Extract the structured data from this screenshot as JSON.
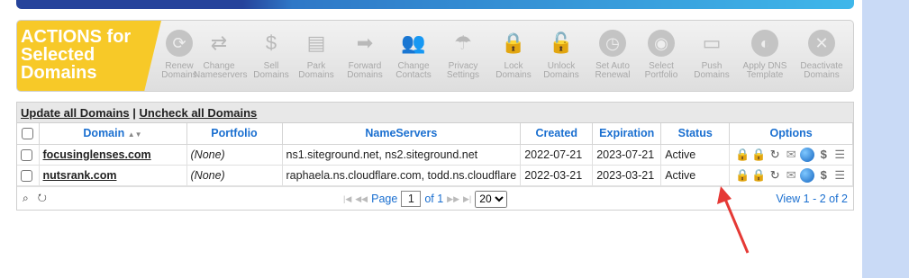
{
  "actions": {
    "title": "ACTIONS for\nSelected\nDomains",
    "items": [
      {
        "label": "Renew Domains",
        "icon": "renew-icon",
        "glyph": "⟳"
      },
      {
        "label": "Change Nameservers",
        "icon": "arrows-icon",
        "glyph": "⇄"
      },
      {
        "label": "Sell Domains",
        "icon": "dollar-icon",
        "glyph": "$"
      },
      {
        "label": "Park Domains",
        "icon": "bus-icon",
        "glyph": "▤"
      },
      {
        "label": "Forward Domains",
        "icon": "forward-arrow-icon",
        "glyph": "➡"
      },
      {
        "label": "Change Contacts",
        "icon": "contacts-icon",
        "glyph": "👥"
      },
      {
        "label": "Privacy Settings",
        "icon": "privacy-icon",
        "glyph": "☂"
      },
      {
        "label": "Lock Domains",
        "icon": "lock-icon",
        "glyph": "🔒"
      },
      {
        "label": "Unlock Domains",
        "icon": "unlock-icon",
        "glyph": "🔓"
      },
      {
        "label": "Set Auto Renewal",
        "icon": "clock-icon",
        "glyph": "◷"
      },
      {
        "label": "Select Portfolio",
        "icon": "disc-icon",
        "glyph": "◉"
      },
      {
        "label": "Push Domains",
        "icon": "computers-icon",
        "glyph": "▭"
      },
      {
        "label": "Apply DNS Template",
        "icon": "dns-template-icon",
        "glyph": "◐"
      },
      {
        "label": "Deactivate Domains",
        "icon": "deactivate-icon",
        "glyph": "✕"
      }
    ]
  },
  "grid": {
    "update_all_label": "Update all Domains",
    "separator": " | ",
    "uncheck_all_label": "Uncheck all Domains",
    "columns": [
      "Domain",
      "Portfolio",
      "NameServers",
      "Created",
      "Expiration",
      "Status",
      "Options"
    ],
    "sort_indicator": "▲▼",
    "rows": [
      {
        "domain": "focusinglenses.com",
        "portfolio": "(None)",
        "nameservers": "ns1.siteground.net, ns2.siteground.net",
        "created": "2022-07-21",
        "expiration": "2023-07-21",
        "status": "Active"
      },
      {
        "domain": "nutsrank.com",
        "portfolio": "(None)",
        "nameservers": "raphaela.ns.cloudflare.com, todd.ns.cloudflare",
        "created": "2022-03-21",
        "expiration": "2023-03-21",
        "status": "Active"
      }
    ]
  },
  "pager": {
    "page_label": "Page",
    "page_value": "1",
    "of_label": "of 1",
    "page_size": "20",
    "view_text": "View 1 - 2 of 2"
  }
}
